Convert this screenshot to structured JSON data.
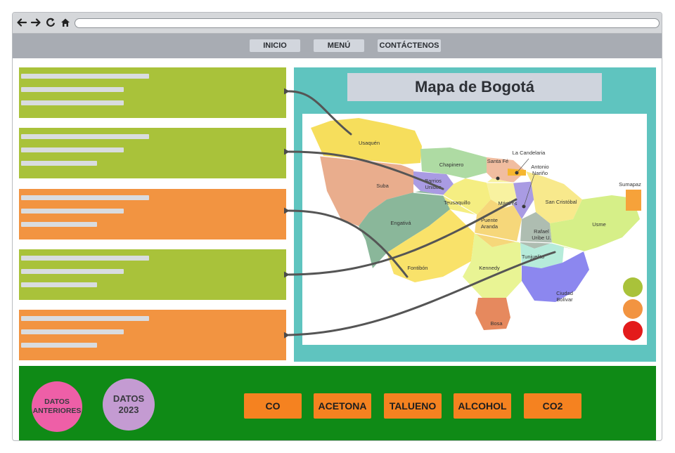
{
  "browser": {
    "back_icon": "arrow-left-icon",
    "forward_icon": "arrow-right-icon",
    "reload_icon": "reload-icon",
    "home_icon": "home-icon",
    "address": ""
  },
  "menu": {
    "items": [
      {
        "label": "INICIO"
      },
      {
        "label": "MENÚ"
      },
      {
        "label": "CONTÁCTENOS"
      }
    ]
  },
  "panels": [
    {
      "color": "#a9c23a",
      "status": "green"
    },
    {
      "color": "#a9c23a",
      "status": "green"
    },
    {
      "color": "#f29441",
      "status": "orange"
    },
    {
      "color": "#a9c23a",
      "status": "green"
    },
    {
      "color": "#f29441",
      "status": "orange"
    }
  ],
  "map": {
    "title": "Mapa de Bogotá",
    "localities": {
      "usaquen": "Usaquén",
      "chapinero": "Chapinero",
      "santa_fe": "Santa Fé",
      "la_candelaria": "La Candelaria",
      "antonio_narino_1": "Antonio",
      "antonio_narino_2": "Nariño",
      "barrios_unidos_1": "Barrios",
      "barrios_unidos_2": "Unidos",
      "suba": "Suba",
      "teusaquillo": "Teusaquillo",
      "martires": "Mártires",
      "san_cristobal": "San Cristóbal",
      "sumapaz": "Sumapaz",
      "engativa": "Engativá",
      "puente_aranda_1": "Puente",
      "puente_aranda_2": "Aranda",
      "rafael_uribe_1": "Rafael",
      "rafael_uribe_2": "Uribe U.",
      "usme": "Usme",
      "fontibon": "Fontibón",
      "kennedy": "Kennedy",
      "tunjuelito": "Tunjuelito",
      "ciudad_bolivar_1": "Ciudad",
      "ciudad_bolivar_2": "Bolívar",
      "bosa": "Bosa"
    },
    "legend": [
      {
        "color": "#a9c23a",
        "meaning": "green"
      },
      {
        "color": "#f29441",
        "meaning": "orange"
      },
      {
        "color": "#e31b1b",
        "meaning": "red"
      }
    ]
  },
  "bottom": {
    "previous_data": "DATOS\nANTERIORES",
    "data_2023": "DATOS\n2023",
    "gases": [
      {
        "label": "CO"
      },
      {
        "label": "ACETONA"
      },
      {
        "label": "TALUENO"
      },
      {
        "label": "ALCOHOL"
      },
      {
        "label": "CO2"
      }
    ]
  },
  "colors": {
    "green_panel": "#a9c23a",
    "orange_panel": "#f29441",
    "teal_frame": "#5fc4bf",
    "bottom_bar": "#0f8a16",
    "gas_button": "#f58220",
    "previous_data_circle": "#ee5fa7",
    "data_2023_circle": "#c49bd2"
  }
}
